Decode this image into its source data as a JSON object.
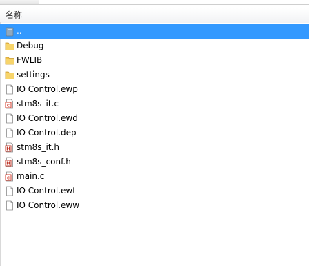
{
  "header": {
    "name_col": "名称"
  },
  "files": [
    {
      "name": "..",
      "type": "parent-icon",
      "selected": true
    },
    {
      "name": "Debug",
      "type": "folder-icon",
      "selected": false
    },
    {
      "name": "FWLIB",
      "type": "folder-icon",
      "selected": false
    },
    {
      "name": "settings",
      "type": "folder-icon",
      "selected": false
    },
    {
      "name": "IO Control.ewp",
      "type": "file-icon",
      "selected": false
    },
    {
      "name": "stm8s_it.c",
      "type": "c-source-icon",
      "selected": false
    },
    {
      "name": "IO Control.ewd",
      "type": "file-icon",
      "selected": false
    },
    {
      "name": "IO Control.dep",
      "type": "file-icon",
      "selected": false
    },
    {
      "name": "stm8s_it.h",
      "type": "h-header-icon",
      "selected": false
    },
    {
      "name": "stm8s_conf.h",
      "type": "h-header-icon",
      "selected": false
    },
    {
      "name": "main.c",
      "type": "c-source-icon",
      "selected": false
    },
    {
      "name": "IO Control.ewt",
      "type": "file-icon",
      "selected": false
    },
    {
      "name": "IO Control.eww",
      "type": "file-icon",
      "selected": false
    }
  ],
  "colors": {
    "selection": "#3399ff",
    "folder": "#f2c14b",
    "c_badge": "#d23a2a",
    "h_badge": "#c0392b"
  }
}
